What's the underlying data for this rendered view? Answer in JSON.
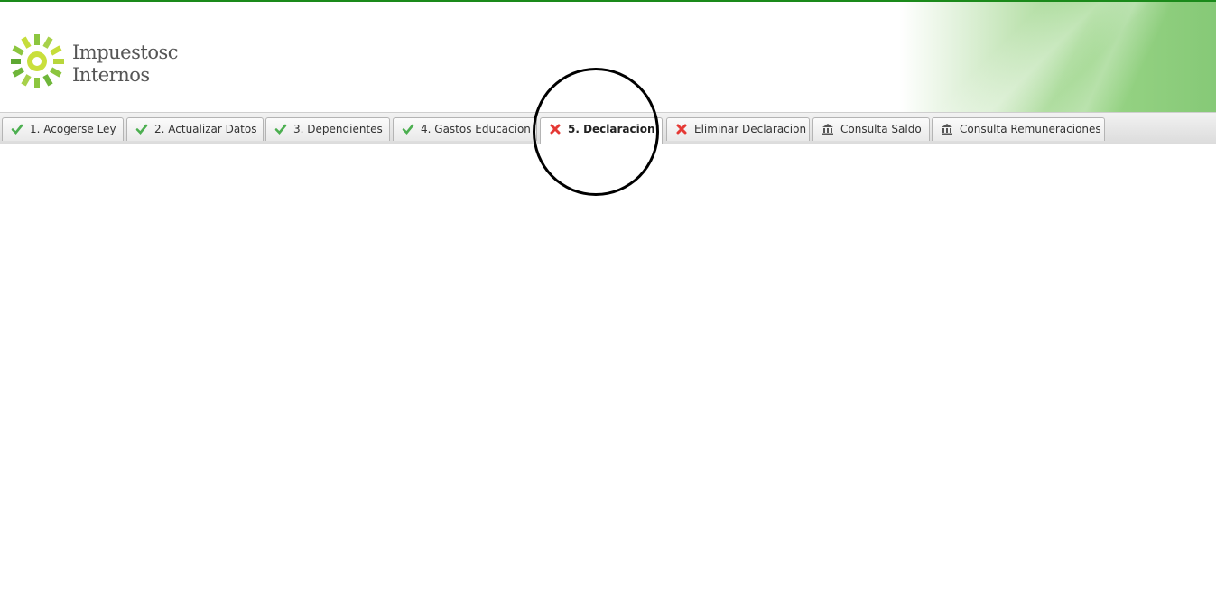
{
  "header": {
    "logo_line1": "Impuestosc",
    "logo_line2": "Internos",
    "logo_icon": "sun-logo-icon",
    "brand_green": "#7cc143"
  },
  "tabs": [
    {
      "label": "1. Acogerse Ley",
      "icon": "check-icon",
      "status": "done"
    },
    {
      "label": "2. Actualizar Datos",
      "icon": "check-icon",
      "status": "done"
    },
    {
      "label": "3. Dependientes",
      "icon": "check-icon",
      "status": "done"
    },
    {
      "label": "4. Gastos Educacion",
      "icon": "check-icon",
      "status": "done"
    },
    {
      "label": "5. Declaracion",
      "icon": "x-icon",
      "status": "active"
    },
    {
      "label": "Eliminar Declaracion",
      "icon": "x-icon",
      "status": "pending"
    },
    {
      "label": "Consulta Saldo",
      "icon": "bank-icon",
      "status": "pending"
    },
    {
      "label": "Consulta Remuneraciones",
      "icon": "bank-icon",
      "status": "pending"
    }
  ],
  "colors": {
    "check": "#4caf50",
    "x": "#e53935",
    "bank": "#555555",
    "top_line": "#1a8a1a"
  }
}
